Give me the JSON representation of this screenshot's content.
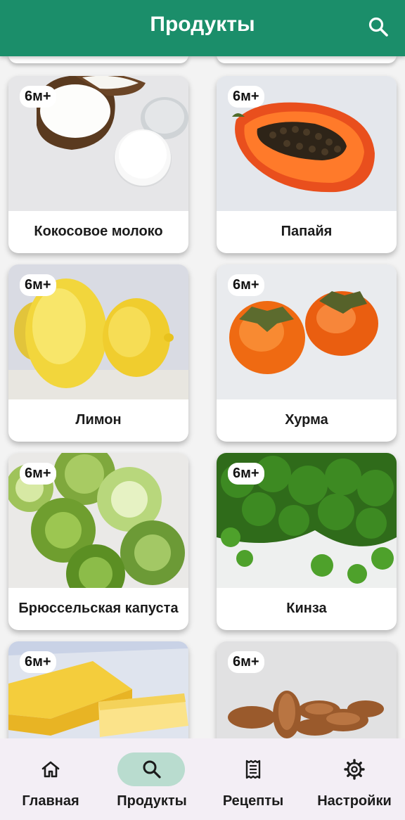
{
  "appbar": {
    "title": "Продукты",
    "search_icon": "search-icon"
  },
  "products": [
    {
      "name": "Кокосовое молоко",
      "age": "6м+"
    },
    {
      "name": "Папайя",
      "age": "6м+"
    },
    {
      "name": "Лимон",
      "age": "6м+"
    },
    {
      "name": "Хурма",
      "age": "6м+"
    },
    {
      "name": "Брюссельская капуста",
      "age": "6м+"
    },
    {
      "name": "Кинза",
      "age": "6м+"
    },
    {
      "name": "",
      "age": "6м+"
    },
    {
      "name": "",
      "age": "6м+"
    }
  ],
  "bottom_nav": {
    "items": [
      {
        "label": "Главная",
        "icon": "home-icon",
        "active": false
      },
      {
        "label": "Продукты",
        "icon": "search-icon",
        "active": true
      },
      {
        "label": "Рецепты",
        "icon": "receipt-icon",
        "active": false
      },
      {
        "label": "Настройки",
        "icon": "gear-icon",
        "active": false
      }
    ]
  },
  "colors": {
    "primary": "#1b8e6a",
    "nav_active": "#b9dccf",
    "nav_bg": "#f3eef5"
  }
}
